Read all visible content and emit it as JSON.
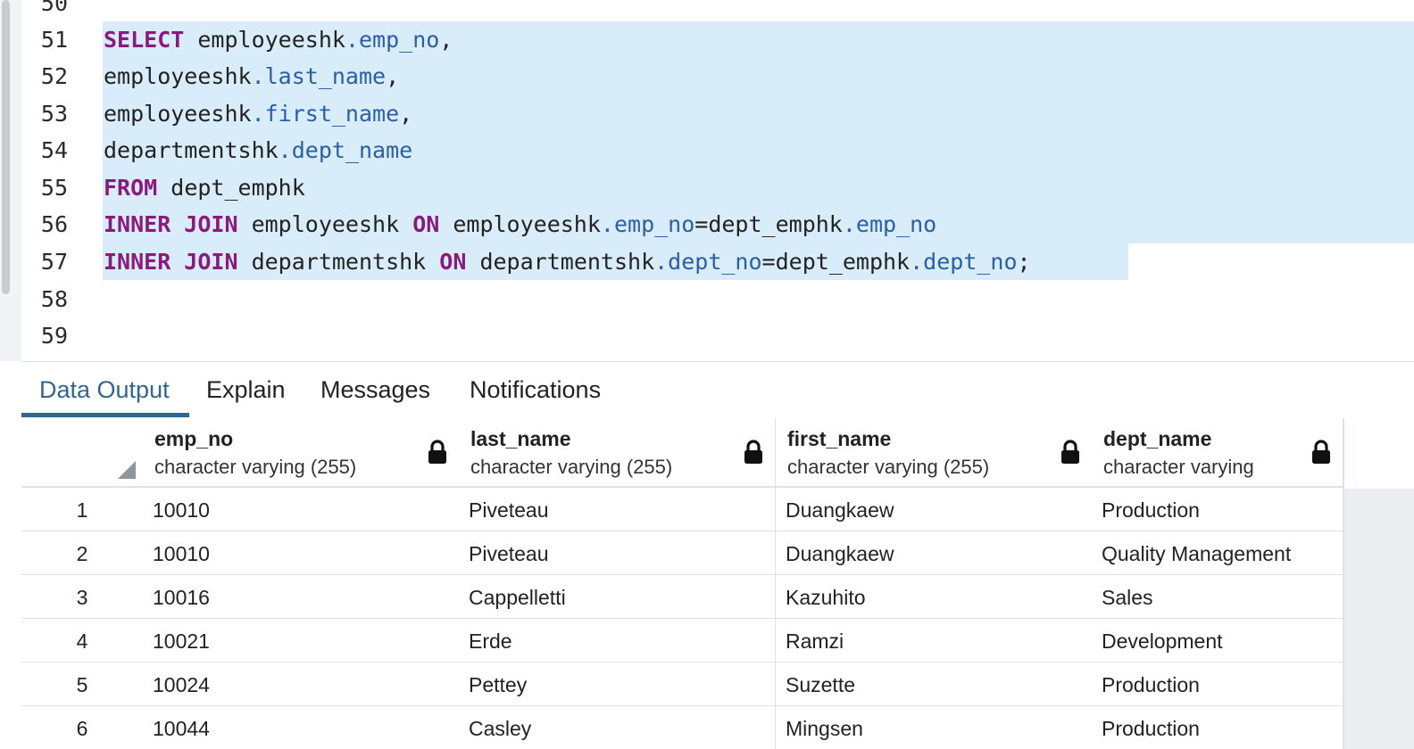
{
  "editor": {
    "lines": [
      {
        "num": "50",
        "tokens": []
      },
      {
        "num": "51",
        "tokens": [
          {
            "t": "SELECT",
            "c": "kw"
          },
          {
            "t": " employeeshk",
            "c": "plain"
          },
          {
            "t": ".emp_no",
            "c": "prop"
          },
          {
            "t": ",",
            "c": "plain"
          }
        ]
      },
      {
        "num": "52",
        "tokens": [
          {
            "t": "employeeshk",
            "c": "plain"
          },
          {
            "t": ".last_name",
            "c": "prop"
          },
          {
            "t": ",",
            "c": "plain"
          }
        ]
      },
      {
        "num": "53",
        "tokens": [
          {
            "t": "employeeshk",
            "c": "plain"
          },
          {
            "t": ".first_name",
            "c": "prop"
          },
          {
            "t": ",",
            "c": "plain"
          }
        ]
      },
      {
        "num": "54",
        "tokens": [
          {
            "t": "departmentshk",
            "c": "plain"
          },
          {
            "t": ".dept_name",
            "c": "prop"
          }
        ]
      },
      {
        "num": "55",
        "tokens": [
          {
            "t": "FROM",
            "c": "kw"
          },
          {
            "t": " dept_emphk",
            "c": "plain"
          }
        ]
      },
      {
        "num": "56",
        "tokens": [
          {
            "t": "INNER JOIN",
            "c": "kw"
          },
          {
            "t": " employeeshk ",
            "c": "plain"
          },
          {
            "t": "ON",
            "c": "kw"
          },
          {
            "t": " employeeshk",
            "c": "plain"
          },
          {
            "t": ".emp_no",
            "c": "prop"
          },
          {
            "t": "=dept_emphk",
            "c": "plain"
          },
          {
            "t": ".emp_no",
            "c": "prop"
          }
        ]
      },
      {
        "num": "57",
        "tokens": [
          {
            "t": "INNER JOIN",
            "c": "kw"
          },
          {
            "t": " departmentshk ",
            "c": "plain"
          },
          {
            "t": "ON",
            "c": "kw"
          },
          {
            "t": " departmentshk",
            "c": "plain"
          },
          {
            "t": ".dept_no",
            "c": "prop"
          },
          {
            "t": "=dept_emphk",
            "c": "plain"
          },
          {
            "t": ".dept_no",
            "c": "prop"
          },
          {
            "t": ";",
            "c": "plain"
          }
        ]
      },
      {
        "num": "58",
        "tokens": []
      },
      {
        "num": "59",
        "tokens": []
      }
    ]
  },
  "tabs": {
    "data_output": "Data Output",
    "explain": "Explain",
    "messages": "Messages",
    "notifications": "Notifications"
  },
  "grid": {
    "columns": [
      {
        "name": "emp_no",
        "type": "character varying (255)"
      },
      {
        "name": "last_name",
        "type": "character varying (255)"
      },
      {
        "name": "first_name",
        "type": "character varying (255)"
      },
      {
        "name": "dept_name",
        "type": "character varying"
      }
    ],
    "rows": [
      {
        "n": "1",
        "cells": [
          "10010",
          "Piveteau",
          "Duangkaew",
          "Production"
        ]
      },
      {
        "n": "2",
        "cells": [
          "10010",
          "Piveteau",
          "Duangkaew",
          "Quality Management"
        ]
      },
      {
        "n": "3",
        "cells": [
          "10016",
          "Cappelletti",
          "Kazuhito",
          "Sales"
        ]
      },
      {
        "n": "4",
        "cells": [
          "10021",
          "Erde",
          "Ramzi",
          "Development"
        ]
      },
      {
        "n": "5",
        "cells": [
          "10024",
          "Pettey",
          "Suzette",
          "Production"
        ]
      },
      {
        "n": "6",
        "cells": [
          "10044",
          "Casley",
          "Mingsen",
          "Production"
        ]
      }
    ]
  },
  "colors": {
    "keyword": "#8a1a7e",
    "property": "#2a5fa8",
    "selection": "#d9ecf9",
    "active_tab": "#326690"
  }
}
